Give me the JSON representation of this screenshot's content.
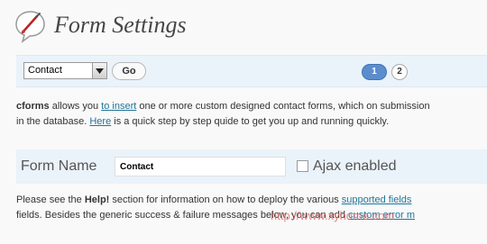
{
  "header": {
    "title": "Form Settings"
  },
  "toolbar": {
    "form_select": {
      "selected": "Contact"
    },
    "go_label": "Go",
    "pages": [
      "1",
      "2"
    ],
    "current_page": "1"
  },
  "intro": {
    "line1_brand": "cforms",
    "line1_a": " allows you ",
    "line1_link": "to insert",
    "line1_b": " one or more custom designed contact forms, which on submission",
    "line2_a": "in the database. ",
    "line2_link": "Here",
    "line2_b": " is a quick step by step quide to get you up and running quickly."
  },
  "form": {
    "name_label": "Form Name",
    "name_value": "Contact",
    "ajax_label": "Ajax enabled",
    "ajax_checked": false
  },
  "help": {
    "line1_a": "Please see the ",
    "line1_bold": "Help!",
    "line1_b": " section for information on how to deploy the various ",
    "line1_link": "supported fields",
    "line2_a": "fields. Besides the generic success & failure messages below, you can add ",
    "line2_link": "custom error m"
  },
  "watermark": "http://www.xyhome.com"
}
